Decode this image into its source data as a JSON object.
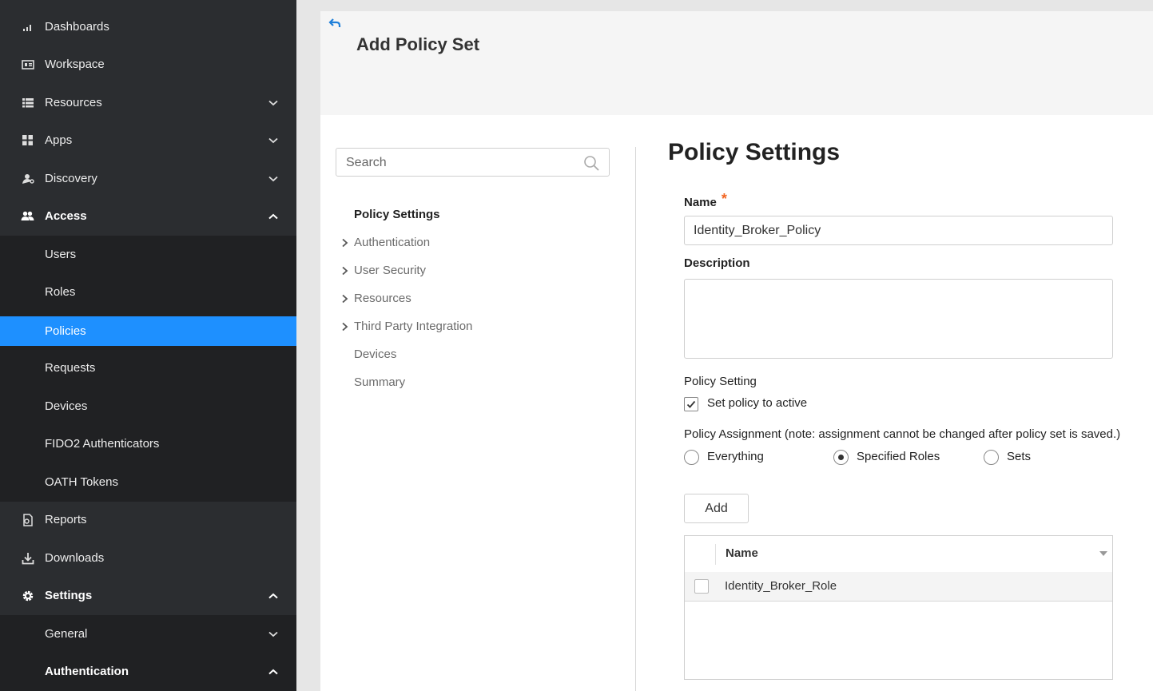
{
  "sidebar": {
    "items": [
      {
        "label": "Dashboards",
        "icon": "bar-chart-icon"
      },
      {
        "label": "Workspace",
        "icon": "workspace-icon"
      },
      {
        "label": "Resources",
        "icon": "list-icon"
      },
      {
        "label": "Apps",
        "icon": "apps-grid-icon"
      },
      {
        "label": "Discovery",
        "icon": "discovery-icon"
      },
      {
        "label": "Access",
        "icon": "users-icon"
      },
      {
        "label": "Users"
      },
      {
        "label": "Roles"
      },
      {
        "label": "Policies"
      },
      {
        "label": "Requests"
      },
      {
        "label": "Devices"
      },
      {
        "label": "FIDO2 Authenticators"
      },
      {
        "label": "OATH Tokens"
      },
      {
        "label": "Reports",
        "icon": "report-icon"
      },
      {
        "label": "Downloads",
        "icon": "download-icon"
      },
      {
        "label": "Settings",
        "icon": "gear-icon"
      },
      {
        "label": "General"
      },
      {
        "label": "Authentication"
      }
    ],
    "active_color": "#1e90ff"
  },
  "header": {
    "title": "Add Policy Set"
  },
  "section_nav": {
    "search_placeholder": "Search",
    "items": [
      {
        "label": "Policy Settings"
      },
      {
        "label": "Authentication"
      },
      {
        "label": "User Security"
      },
      {
        "label": "Resources"
      },
      {
        "label": "Third Party Integration"
      },
      {
        "label": "Devices"
      },
      {
        "label": "Summary"
      }
    ]
  },
  "form": {
    "title": "Policy Settings",
    "name_label": "Name",
    "required_mark": "*",
    "name_value": "Identity_Broker_Policy",
    "description_label": "Description",
    "description_value": "",
    "policy_setting_label": "Policy Setting",
    "active_checkbox_label": "Set policy to active",
    "active_checked": true,
    "assignment_label": "Policy Assignment (note: assignment cannot be changed after policy set is saved.)",
    "assignment_options": [
      {
        "label": "Everything",
        "selected": false
      },
      {
        "label": "Specified Roles",
        "selected": true
      },
      {
        "label": "Sets",
        "selected": false
      }
    ],
    "add_button_label": "Add",
    "grid": {
      "column_header": "Name",
      "rows": [
        {
          "name": "Identity_Broker_Role"
        }
      ]
    }
  }
}
